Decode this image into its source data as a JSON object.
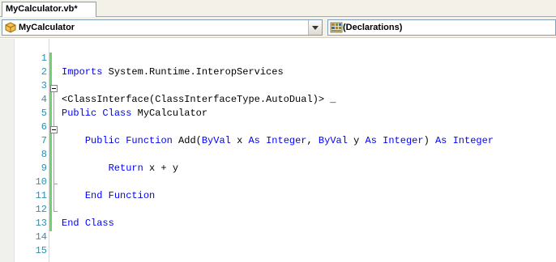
{
  "tab": {
    "title": "MyCalculator.vb*"
  },
  "navbar": {
    "class_combo": {
      "value": "MyCalculator",
      "icon": "class-icon"
    },
    "member_combo": {
      "value": "(Declarations)",
      "icon": "declarations-icon"
    }
  },
  "editor": {
    "lines": [
      {
        "num": "1",
        "tokens": []
      },
      {
        "num": "2",
        "tokens": [
          {
            "t": "Imports",
            "k": true
          },
          {
            "t": " System.Runtime.InteropServices",
            "k": false
          }
        ]
      },
      {
        "num": "3",
        "tokens": []
      },
      {
        "num": "4",
        "tokens": [
          {
            "t": "<ClassInterface(ClassInterfaceType.AutoDual)> _",
            "k": false
          }
        ]
      },
      {
        "num": "5",
        "tokens": [
          {
            "t": "Public",
            "k": true
          },
          {
            "t": " ",
            "k": false
          },
          {
            "t": "Class",
            "k": true
          },
          {
            "t": " MyCalculator",
            "k": false
          }
        ]
      },
      {
        "num": "6",
        "tokens": []
      },
      {
        "num": "7",
        "tokens": [
          {
            "t": "    ",
            "k": false
          },
          {
            "t": "Public",
            "k": true
          },
          {
            "t": " ",
            "k": false
          },
          {
            "t": "Function",
            "k": true
          },
          {
            "t": " Add(",
            "k": false
          },
          {
            "t": "ByVal",
            "k": true
          },
          {
            "t": " x ",
            "k": false
          },
          {
            "t": "As",
            "k": true
          },
          {
            "t": " ",
            "k": false
          },
          {
            "t": "Integer",
            "k": true
          },
          {
            "t": ", ",
            "k": false
          },
          {
            "t": "ByVal",
            "k": true
          },
          {
            "t": " y ",
            "k": false
          },
          {
            "t": "As",
            "k": true
          },
          {
            "t": " ",
            "k": false
          },
          {
            "t": "Integer",
            "k": true
          },
          {
            "t": ") ",
            "k": false
          },
          {
            "t": "As",
            "k": true
          },
          {
            "t": " ",
            "k": false
          },
          {
            "t": "Integer",
            "k": true
          }
        ]
      },
      {
        "num": "8",
        "tokens": []
      },
      {
        "num": "9",
        "tokens": [
          {
            "t": "        ",
            "k": false
          },
          {
            "t": "Return",
            "k": true
          },
          {
            "t": " x + y",
            "k": false
          }
        ]
      },
      {
        "num": "10",
        "tokens": []
      },
      {
        "num": "11",
        "tokens": [
          {
            "t": "    ",
            "k": false
          },
          {
            "t": "End",
            "k": true
          },
          {
            "t": " ",
            "k": false
          },
          {
            "t": "Function",
            "k": true
          }
        ]
      },
      {
        "num": "12",
        "tokens": []
      },
      {
        "num": "13",
        "tokens": [
          {
            "t": "End",
            "k": true
          },
          {
            "t": " ",
            "k": false
          },
          {
            "t": "Class",
            "k": true
          }
        ]
      },
      {
        "num": "14",
        "tokens": []
      },
      {
        "num": "15",
        "tokens": []
      }
    ]
  },
  "colors": {
    "keyword": "#0000ff",
    "line_number": "#2b91af",
    "change_bar": "#6fd16f"
  }
}
